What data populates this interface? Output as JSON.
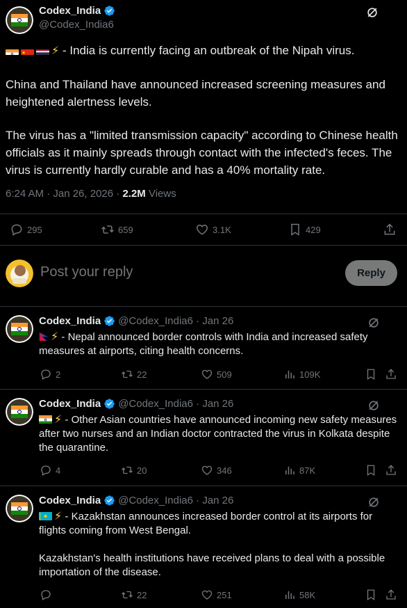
{
  "colors": {
    "accent": "#1d9bf0",
    "background": "#000000",
    "text": "#e7e9ea",
    "muted": "#71767b",
    "divider": "#2f3336",
    "reply_button_bg": "#787a7a"
  },
  "main_tweet": {
    "author_name": "Codex_India",
    "handle": "@Codex_India6",
    "flags": [
      "india-flag",
      "china-flag",
      "thailand-flag"
    ],
    "bolt": "⚡",
    "para1": "- India is currently facing an outbreak of the Nipah virus.",
    "para2": "China and Thailand have announced increased screening measures and heightened alertness levels.",
    "para3": "The virus has a \"limited transmission capacity\" according to Chinese health officials as it mainly spreads through contact with the infected's feces. The virus is currently hardly curable and has a 40% mortality rate.",
    "timestamp": "6:24 AM · Jan 26, 2026 · ",
    "views_count": "2.2M",
    "views_label": " Views",
    "replies": "295",
    "reposts": "659",
    "likes": "3.1K",
    "bookmarks": "429"
  },
  "reply_box": {
    "placeholder": "Post your reply",
    "button_label": "Reply"
  },
  "replies": [
    {
      "author_name": "Codex_India",
      "handle_date": "@Codex_India6 · Jan 26",
      "flag": "nepal-flag",
      "bolt": "⚡",
      "text": "- Nepal announced border controls with India and increased safety measures at airports, citing health concerns.",
      "replies": "2",
      "reposts": "22",
      "likes": "509",
      "views": "109K"
    },
    {
      "author_name": "Codex_India",
      "handle_date": "@Codex_India6 · Jan 26",
      "flag": "india-flag",
      "bolt": "⚡",
      "text": "- Other Asian countries have announced incoming new safety measures after two nurses and an Indian doctor contracted the virus in Kolkata despite the quarantine.",
      "replies": "4",
      "reposts": "20",
      "likes": "346",
      "views": "87K"
    },
    {
      "author_name": "Codex_India",
      "handle_date": "@Codex_India6 · Jan 26",
      "flag": "kazakhstan-flag",
      "bolt": "⚡",
      "text": "- Kazakhstan announces increased border control at its airports for flights coming from West Bengal.",
      "text2": "Kazakhstan's health institutions have received plans to deal with a possible importation of the disease.",
      "replies": "",
      "reposts": "22",
      "likes": "251",
      "views": "58K"
    }
  ]
}
